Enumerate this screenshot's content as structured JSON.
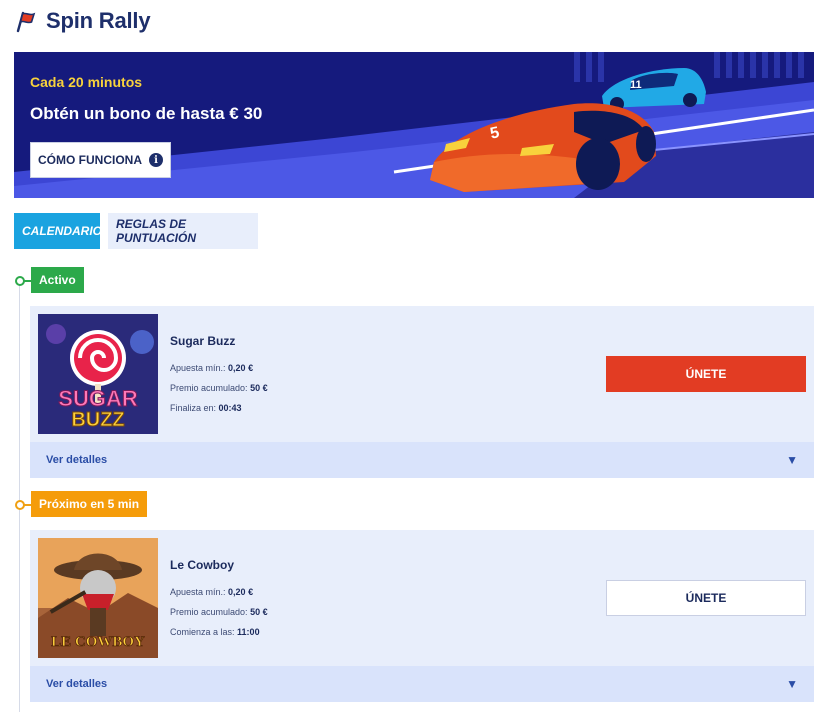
{
  "header": {
    "title": "Spin Rally",
    "icon": "flag-icon"
  },
  "banner": {
    "subtitle": "Cada 20 minutos",
    "headline": "Obtén un bono de hasta € 30",
    "how_button": "CÓMO FUNCIONA",
    "info_icon_glyph": "i",
    "car_front_number": "5",
    "car_back_number": "11"
  },
  "tabs": [
    {
      "label": "CALENDARIO",
      "active": true
    },
    {
      "label": "REGLAS DE PUNTUACIÓN",
      "active": false
    }
  ],
  "events": [
    {
      "status": "Activo",
      "status_color": "#2ca94a",
      "game": "Sugar Buzz",
      "thumb_text_1": "SUGAR",
      "thumb_text_2": "BUZZ",
      "min_bet_label": "Apuesta mín.:",
      "min_bet": "0,20 €",
      "prize_label": "Premio acumulado:",
      "prize": "50 €",
      "time_label": "Finaliza en:",
      "time": "00:43",
      "join_label": "ÚNETE",
      "details_label": "Ver detalles"
    },
    {
      "status": "Próximo en 5 min",
      "status_color": "#f59c0a",
      "game": "Le Cowboy",
      "thumb_text_1": "LE COWBOY",
      "min_bet_label": "Apuesta mín.:",
      "min_bet": "0,20 €",
      "prize_label": "Premio acumulado:",
      "prize": "50 €",
      "time_label": "Comienza a las:",
      "time": "11:00",
      "join_label": "ÚNETE",
      "details_label": "Ver detalles"
    }
  ],
  "colors": {
    "accent_blue": "#1aa3e0",
    "join_red": "#e23c23",
    "banner_bg": "#151a7d",
    "card_bg": "#e8eefb"
  }
}
